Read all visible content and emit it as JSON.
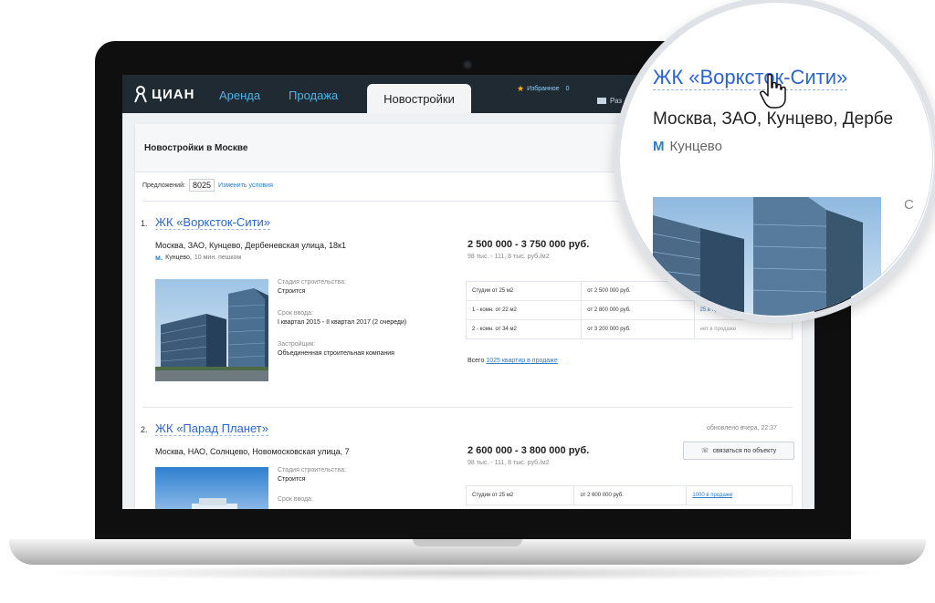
{
  "header": {
    "logo": "ЦИАН",
    "nav": [
      "Аренда",
      "Продажа"
    ],
    "active_tab": "Новостройки",
    "favorites": "Избранное",
    "favorites_count": "0",
    "post_ad": "Раз"
  },
  "page": {
    "title": "Новостройки в Москве",
    "offers_label": "Предложений:",
    "offers_count": "8025",
    "change_conditions": "Изменить условия"
  },
  "listings": [
    {
      "num": "1.",
      "title": "ЖК «Ворксток-Сити»",
      "address": "Москва, ЗАО, Кунцево, Дербеневская улица, 18к1",
      "metro_icon": "м.",
      "metro": "Кунцево,",
      "walk": "10 мин. пешком",
      "stage_label": "Стадия строительства:",
      "stage": "Строится",
      "deadline_label": "Срок ввода:",
      "deadline": "I квартал 2015 - II квартал 2017 (2 очереди)",
      "developer_label": "Застройщик:",
      "developer": "Объединенная строительная компания",
      "price": "2 500 000 - 3 750 000 руб.",
      "price_sub": "98 тыс. - 111, 8 тыс. руб./м2",
      "apartments": [
        {
          "type": "Студии от 25 м2",
          "price": "от 2 500 000 руб.",
          "status": ""
        },
        {
          "type": "1 - комн. от 22 м2",
          "price": "от 2 800 000 руб.",
          "status": "25 в продаже"
        },
        {
          "type": "2 - комн. от 34 м2",
          "price": "от 3 200 000 руб.",
          "status": "нет в продаже"
        }
      ],
      "total_label": "Всего",
      "total_link": "1025 квартир в продаже"
    },
    {
      "num": "2.",
      "title": "ЖК «Парад Планет»",
      "updated": "обновлено вчера, 22:37",
      "address": "Москва, НАО, Солнцево, Новомосковская улица, 7",
      "stage_label": "Стадия строительства:",
      "stage": "Строится",
      "deadline_label": "Срок ввода:",
      "price": "2 600 000 - 3 800 000 руб.",
      "price_sub": "98 тыс. - 111, 8 тыс. руб./м2",
      "contact": "связаться по объекту",
      "apartments": [
        {
          "type": "Студии от 25 м2",
          "price": "от 2 600 000 руб.",
          "status": "1000 в продаже"
        }
      ]
    }
  ],
  "magnifier": {
    "title": "ЖК «Ворксток-Сити»",
    "address": "Москва, ЗАО, Кунцево, Дербе",
    "metro_icon": "М",
    "metro": "Кунцево",
    "edge_letter": "С"
  },
  "colors": {
    "header_bg": "#1f2a33",
    "link": "#2b65d1",
    "accent_blue": "#4fb3e8",
    "star": "#ffb400"
  },
  "icons": [
    "pin-logo-icon",
    "star-icon",
    "message-icon",
    "phone-icon",
    "hand-cursor-icon",
    "metro-icon"
  ]
}
